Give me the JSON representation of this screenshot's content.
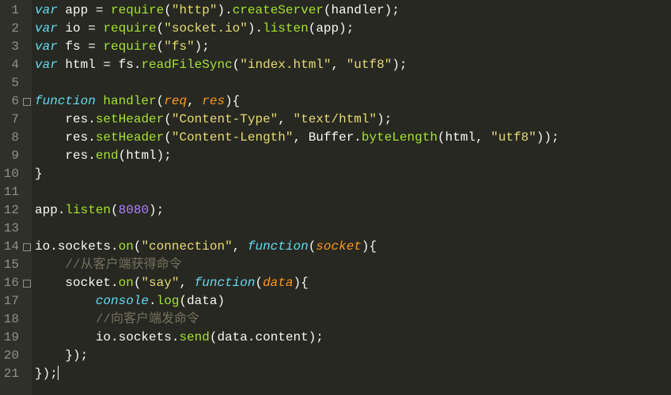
{
  "line_count": 21,
  "fold_markers": {
    "6": true,
    "14": true,
    "16": true
  },
  "lines": {
    "1": [
      [
        "kw",
        "var"
      ],
      [
        "pn",
        " "
      ],
      [
        "id",
        "app"
      ],
      [
        "pn",
        " = "
      ],
      [
        "fn",
        "require"
      ],
      [
        "pn",
        "("
      ],
      [
        "str",
        "\"http\""
      ],
      [
        "pn",
        ")."
      ],
      [
        "fn",
        "createServer"
      ],
      [
        "pn",
        "("
      ],
      [
        "id",
        "handler"
      ],
      [
        "pn",
        ");"
      ]
    ],
    "2": [
      [
        "kw",
        "var"
      ],
      [
        "pn",
        " "
      ],
      [
        "id",
        "io"
      ],
      [
        "pn",
        " = "
      ],
      [
        "fn",
        "require"
      ],
      [
        "pn",
        "("
      ],
      [
        "str",
        "\"socket.io\""
      ],
      [
        "pn",
        ")."
      ],
      [
        "fn",
        "listen"
      ],
      [
        "pn",
        "("
      ],
      [
        "id",
        "app"
      ],
      [
        "pn",
        ");"
      ]
    ],
    "3": [
      [
        "kw",
        "var"
      ],
      [
        "pn",
        " "
      ],
      [
        "id",
        "fs"
      ],
      [
        "pn",
        " = "
      ],
      [
        "fn",
        "require"
      ],
      [
        "pn",
        "("
      ],
      [
        "str",
        "\"fs\""
      ],
      [
        "pn",
        ");"
      ]
    ],
    "4": [
      [
        "kw",
        "var"
      ],
      [
        "pn",
        " "
      ],
      [
        "id",
        "html"
      ],
      [
        "pn",
        " = "
      ],
      [
        "id",
        "fs"
      ],
      [
        "pn",
        "."
      ],
      [
        "fn",
        "readFileSync"
      ],
      [
        "pn",
        "("
      ],
      [
        "str",
        "\"index.html\""
      ],
      [
        "pn",
        ", "
      ],
      [
        "str",
        "\"utf8\""
      ],
      [
        "pn",
        ");"
      ]
    ],
    "5": [
      [
        "pn",
        ""
      ]
    ],
    "6": [
      [
        "fnkw",
        "function"
      ],
      [
        "pn",
        " "
      ],
      [
        "fn",
        "handler"
      ],
      [
        "pn",
        "("
      ],
      [
        "prm",
        "req"
      ],
      [
        "pn",
        ", "
      ],
      [
        "prm",
        "res"
      ],
      [
        "pn",
        "){"
      ]
    ],
    "7": [
      [
        "pn",
        "    "
      ],
      [
        "id",
        "res"
      ],
      [
        "pn",
        "."
      ],
      [
        "fn",
        "setHeader"
      ],
      [
        "pn",
        "("
      ],
      [
        "str",
        "\"Content-Type\""
      ],
      [
        "pn",
        ", "
      ],
      [
        "str",
        "\"text/html\""
      ],
      [
        "pn",
        ");"
      ]
    ],
    "8": [
      [
        "pn",
        "    "
      ],
      [
        "id",
        "res"
      ],
      [
        "pn",
        "."
      ],
      [
        "fn",
        "setHeader"
      ],
      [
        "pn",
        "("
      ],
      [
        "str",
        "\"Content-Length\""
      ],
      [
        "pn",
        ", "
      ],
      [
        "id",
        "Buffer"
      ],
      [
        "pn",
        "."
      ],
      [
        "fn",
        "byteLength"
      ],
      [
        "pn",
        "("
      ],
      [
        "id",
        "html"
      ],
      [
        "pn",
        ", "
      ],
      [
        "str",
        "\"utf8\""
      ],
      [
        "pn",
        "));"
      ]
    ],
    "9": [
      [
        "pn",
        "    "
      ],
      [
        "id",
        "res"
      ],
      [
        "pn",
        "."
      ],
      [
        "fn",
        "end"
      ],
      [
        "pn",
        "("
      ],
      [
        "id",
        "html"
      ],
      [
        "pn",
        ");"
      ]
    ],
    "10": [
      [
        "pn",
        "}"
      ]
    ],
    "11": [
      [
        "pn",
        ""
      ]
    ],
    "12": [
      [
        "id",
        "app"
      ],
      [
        "pn",
        "."
      ],
      [
        "fn",
        "listen"
      ],
      [
        "pn",
        "("
      ],
      [
        "num",
        "8080"
      ],
      [
        "pn",
        ");"
      ]
    ],
    "13": [
      [
        "pn",
        ""
      ]
    ],
    "14": [
      [
        "id",
        "io"
      ],
      [
        "pn",
        "."
      ],
      [
        "id",
        "sockets"
      ],
      [
        "pn",
        "."
      ],
      [
        "fn",
        "on"
      ],
      [
        "pn",
        "("
      ],
      [
        "str",
        "\"connection\""
      ],
      [
        "pn",
        ", "
      ],
      [
        "fnkw",
        "function"
      ],
      [
        "pn",
        "("
      ],
      [
        "prm",
        "socket"
      ],
      [
        "pn",
        "){"
      ]
    ],
    "15": [
      [
        "pn",
        "    "
      ],
      [
        "cm",
        "//从客户端获得命令"
      ]
    ],
    "16": [
      [
        "pn",
        "    "
      ],
      [
        "id",
        "socket"
      ],
      [
        "pn",
        "."
      ],
      [
        "fn",
        "on"
      ],
      [
        "pn",
        "("
      ],
      [
        "str",
        "\"say\""
      ],
      [
        "pn",
        ", "
      ],
      [
        "fnkw",
        "function"
      ],
      [
        "pn",
        "("
      ],
      [
        "prm",
        "data"
      ],
      [
        "pn",
        "){"
      ]
    ],
    "17": [
      [
        "pn",
        "        "
      ],
      [
        "obj",
        "console"
      ],
      [
        "pn",
        "."
      ],
      [
        "fn",
        "log"
      ],
      [
        "pn",
        "("
      ],
      [
        "id",
        "data"
      ],
      [
        "pn",
        ")"
      ]
    ],
    "18": [
      [
        "pn",
        "        "
      ],
      [
        "cm",
        "//向客户端发命令"
      ]
    ],
    "19": [
      [
        "pn",
        "        "
      ],
      [
        "id",
        "io"
      ],
      [
        "pn",
        "."
      ],
      [
        "id",
        "sockets"
      ],
      [
        "pn",
        "."
      ],
      [
        "fn",
        "send"
      ],
      [
        "pn",
        "("
      ],
      [
        "id",
        "data"
      ],
      [
        "pn",
        "."
      ],
      [
        "id",
        "content"
      ],
      [
        "pn",
        ");"
      ]
    ],
    "20": [
      [
        "pn",
        "    });"
      ]
    ],
    "21": [
      [
        "pn",
        "});"
      ]
    ]
  },
  "cursor_line": 21
}
